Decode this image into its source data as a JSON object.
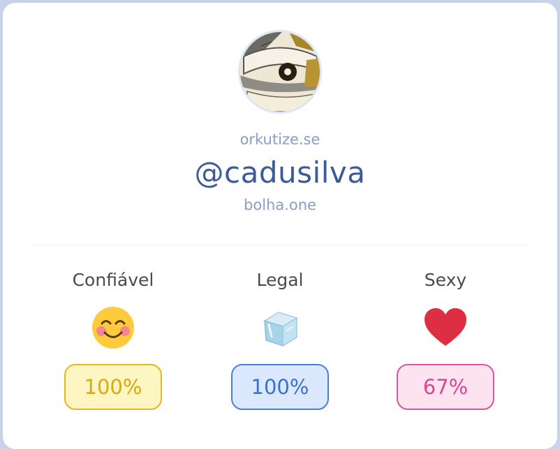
{
  "profile": {
    "instance_top": "orkutize.se",
    "handle": "@cadusilva",
    "instance_bottom": "bolha.one"
  },
  "stats": [
    {
      "label": "Confiável",
      "icon": "smiling-face-icon",
      "value": "100%",
      "level": 1.0,
      "color": "#e3b81c"
    },
    {
      "label": "Legal",
      "icon": "ice-cube-icon",
      "value": "100%",
      "level": 1.0,
      "color": "#4a7fd8"
    },
    {
      "label": "Sexy",
      "icon": "heart-icon",
      "value": "67%",
      "level": 0.67,
      "color": "#e3529b"
    }
  ]
}
